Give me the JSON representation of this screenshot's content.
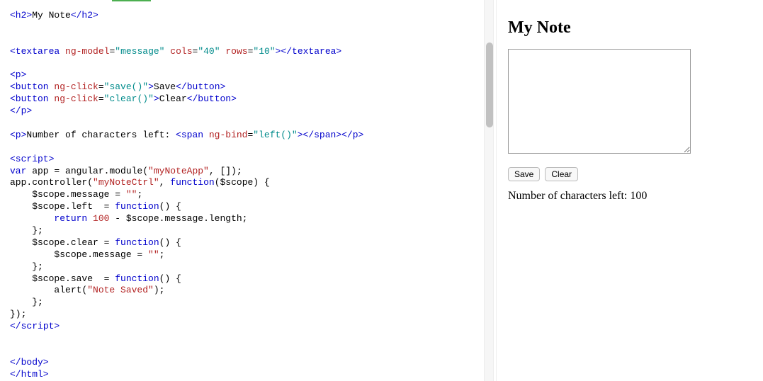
{
  "preview": {
    "heading": "My Note",
    "save_label": "Save",
    "clear_label": "Clear",
    "char_text": "Number of characters left: ",
    "char_count": "100"
  },
  "code_tokens": [
    [
      [
        "tag",
        "<h2>"
      ],
      [
        "txt",
        "My Note"
      ],
      [
        "tag",
        "</h2>"
      ]
    ],
    [],
    [],
    [
      [
        "tag",
        "<textarea"
      ],
      [
        "txt",
        " "
      ],
      [
        "attr",
        "ng-model"
      ],
      [
        "txt",
        "="
      ],
      [
        "str",
        "\"message\""
      ],
      [
        "txt",
        " "
      ],
      [
        "attr",
        "cols"
      ],
      [
        "txt",
        "="
      ],
      [
        "str",
        "\"40\""
      ],
      [
        "txt",
        " "
      ],
      [
        "attr",
        "rows"
      ],
      [
        "txt",
        "="
      ],
      [
        "str",
        "\"10\""
      ],
      [
        "tag",
        "></textarea>"
      ]
    ],
    [],
    [
      [
        "tag",
        "<p>"
      ]
    ],
    [
      [
        "tag",
        "<button"
      ],
      [
        "txt",
        " "
      ],
      [
        "attr",
        "ng-click"
      ],
      [
        "txt",
        "="
      ],
      [
        "str",
        "\"save()\""
      ],
      [
        "tag",
        ">"
      ],
      [
        "txt",
        "Save"
      ],
      [
        "tag",
        "</button>"
      ]
    ],
    [
      [
        "tag",
        "<button"
      ],
      [
        "txt",
        " "
      ],
      [
        "attr",
        "ng-click"
      ],
      [
        "txt",
        "="
      ],
      [
        "str",
        "\"clear()\""
      ],
      [
        "tag",
        ">"
      ],
      [
        "txt",
        "Clear"
      ],
      [
        "tag",
        "</button>"
      ]
    ],
    [
      [
        "tag",
        "</p>"
      ]
    ],
    [],
    [
      [
        "tag",
        "<p>"
      ],
      [
        "txt",
        "Number of characters left: "
      ],
      [
        "tag",
        "<span"
      ],
      [
        "txt",
        " "
      ],
      [
        "attr",
        "ng-bind"
      ],
      [
        "txt",
        "="
      ],
      [
        "str",
        "\"left()\""
      ],
      [
        "tag",
        "></span></p>"
      ]
    ],
    [],
    [
      [
        "tag",
        "<script>"
      ]
    ],
    [
      [
        "kw",
        "var"
      ],
      [
        "txt",
        " app = angular.module("
      ],
      [
        "lit",
        "\"myNoteApp\""
      ],
      [
        "txt",
        ", []);"
      ]
    ],
    [
      [
        "txt",
        "app.controller("
      ],
      [
        "lit",
        "\"myNoteCtrl\""
      ],
      [
        "txt",
        ", "
      ],
      [
        "kw",
        "function"
      ],
      [
        "txt",
        "($scope) {"
      ]
    ],
    [
      [
        "txt",
        "    $scope.message = "
      ],
      [
        "lit",
        "\"\""
      ],
      [
        "txt",
        ";"
      ]
    ],
    [
      [
        "txt",
        "    $scope.left  = "
      ],
      [
        "kw",
        "function"
      ],
      [
        "txt",
        "() {"
      ]
    ],
    [
      [
        "txt",
        "        "
      ],
      [
        "kw",
        "return"
      ],
      [
        "txt",
        " "
      ],
      [
        "num",
        "100"
      ],
      [
        "txt",
        " - $scope.message.length;"
      ]
    ],
    [
      [
        "txt",
        "    };"
      ]
    ],
    [
      [
        "txt",
        "    $scope.clear = "
      ],
      [
        "kw",
        "function"
      ],
      [
        "txt",
        "() {"
      ]
    ],
    [
      [
        "txt",
        "        $scope.message = "
      ],
      [
        "lit",
        "\"\""
      ],
      [
        "txt",
        ";"
      ]
    ],
    [
      [
        "txt",
        "    };"
      ]
    ],
    [
      [
        "txt",
        "    $scope.save  = "
      ],
      [
        "kw",
        "function"
      ],
      [
        "txt",
        "() {"
      ]
    ],
    [
      [
        "txt",
        "        alert("
      ],
      [
        "lit",
        "\"Note Saved\""
      ],
      [
        "txt",
        ");"
      ]
    ],
    [
      [
        "txt",
        "    };"
      ]
    ],
    [
      [
        "txt",
        "});"
      ]
    ],
    [
      [
        "tag",
        "</scr"
      ],
      [
        "tag",
        "ipt>"
      ]
    ],
    [],
    [],
    [
      [
        "tag",
        "</body>"
      ]
    ],
    [
      [
        "tag",
        "</html>"
      ]
    ]
  ]
}
